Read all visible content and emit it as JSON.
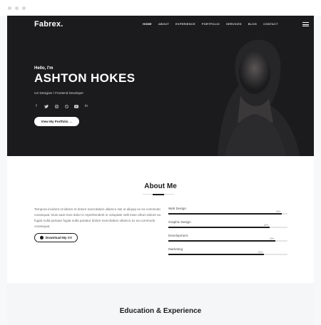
{
  "header": {
    "brand": "Fabrex.",
    "nav": [
      "HOME",
      "ABOUT",
      "EXPERIENCE",
      "PORTFOLIO",
      "SERVICES",
      "BLOG",
      "CONTACT"
    ],
    "menu_icon": "hamburger-icon"
  },
  "hero": {
    "greeting": "Hello, I'm",
    "name": "ASHTON HOKES",
    "role": "UX Designer / Frontend Developer",
    "socials": [
      "facebook-icon",
      "twitter-icon",
      "instagram-icon",
      "dribbble-icon",
      "youtube-icon",
      "linkedin-icon"
    ],
    "cta": "View My Portfolio  →"
  },
  "about": {
    "title": "About Me",
    "text": "Tempora incidunt ut labore et dolore exercitation ullamco nisi ut aliquip ex ea commodo consequat. Duis aute irure dolor in reprehenderit in voluptate velit esse cillum dolore eu fugiat nulla pariatur fugiat nulla pariatur dolore exercitation ullamco ex ea commodo consequat.",
    "cv_button": "Download My CV",
    "skills": [
      {
        "label": "Web Design",
        "percent": 95,
        "pct_text": "95%"
      },
      {
        "label": "Graphic Design",
        "percent": 85,
        "pct_text": "85%"
      },
      {
        "label": "Development",
        "percent": 90,
        "pct_text": "90%"
      },
      {
        "label": "Marketing",
        "percent": 80,
        "pct_text": "80%"
      }
    ]
  },
  "education": {
    "title": "Education & Experience"
  },
  "colors": {
    "hero_bg": "#1b1b1d",
    "accent": "#1b1b1d",
    "track": "#e4e4e6"
  }
}
